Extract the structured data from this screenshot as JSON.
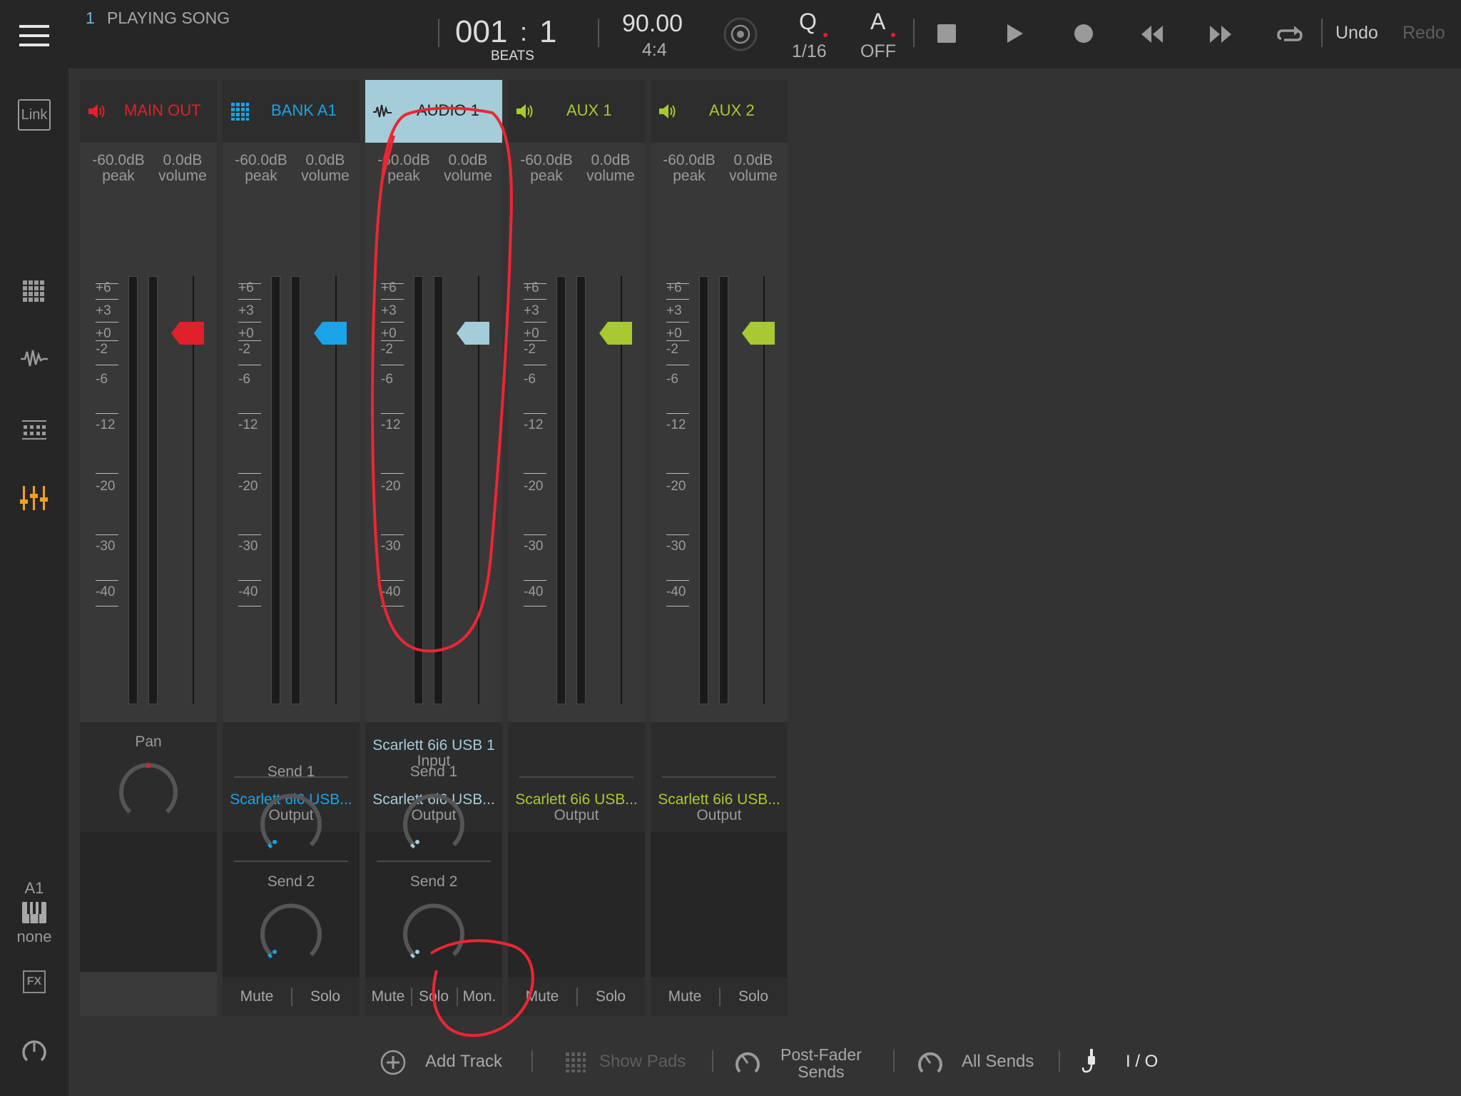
{
  "topbar": {
    "song_number": "1",
    "song_status": "PLAYING SONG",
    "position_bar": "001",
    "position_colon": ":",
    "position_beat": "1",
    "position_unit": "BEATS",
    "tempo": "90.00",
    "time_signature": "4:4",
    "quantize_label": "Q",
    "quantize_value": "1/16",
    "automation_label": "A",
    "automation_value": "OFF",
    "undo_label": "Undo",
    "redo_label": "Redo"
  },
  "sidebar": {
    "link_label": "Link",
    "keyboard_track": "A1",
    "keyboard_value": "none",
    "fx_label": "FX"
  },
  "mixer": {
    "peak_label": "peak",
    "volume_label": "volume",
    "scale": [
      "+6",
      "+3",
      "+0",
      "-2",
      "-6",
      "-12",
      "-20",
      "-30",
      "-40"
    ],
    "pan_label": "Pan",
    "send1_label": "Send 1",
    "send2_label": "Send 2",
    "mute_label": "Mute",
    "solo_label": "Solo",
    "mon_label": "Mon.",
    "output_label": "Output",
    "input_label": "Input",
    "channels": [
      {
        "name": "MAIN OUT",
        "peak": "-60.0dB",
        "volume": "0.0dB",
        "color": "#e0202b",
        "fader_db": 0
      },
      {
        "name": "BANK A1",
        "peak": "-60.0dB",
        "volume": "0.0dB",
        "color": "#1aa3e8",
        "output": "Scarlett 6i6 USB...",
        "fader_db": 0
      },
      {
        "name": "AUDIO 1",
        "peak": "-60.0dB",
        "volume": "0.0dB",
        "color": "#a5ccd9",
        "input": "Scarlett 6i6 USB 1",
        "output": "Scarlett 6i6 USB...",
        "fader_db": 0
      },
      {
        "name": "AUX 1",
        "peak": "-60.0dB",
        "volume": "0.0dB",
        "color": "#a8c932",
        "output": "Scarlett 6i6 USB...",
        "fader_db": 0
      },
      {
        "name": "AUX 2",
        "peak": "-60.0dB",
        "volume": "0.0dB",
        "color": "#a8c932",
        "output": "Scarlett 6i6 USB...",
        "fader_db": 0
      }
    ]
  },
  "bottombar": {
    "add_track": "Add Track",
    "show_pads": "Show Pads",
    "post_fader_line1": "Post-Fader",
    "post_fader_line2": "Sends",
    "all_sends": "All Sends",
    "io": "I / O"
  }
}
